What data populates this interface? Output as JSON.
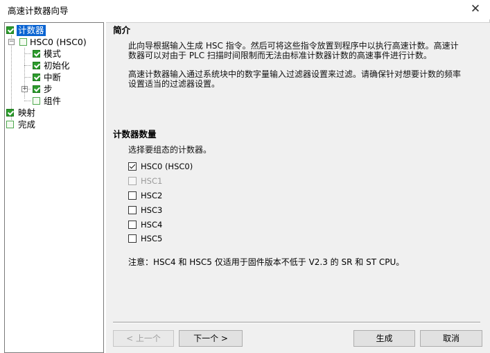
{
  "window": {
    "title": "高速计数器向导",
    "close_symbol": "✕"
  },
  "tree": {
    "items": [
      {
        "label": "计数器",
        "checked": true,
        "selected": true
      },
      {
        "label": "HSC0 (HSC0)",
        "checked": false
      },
      {
        "label": "模式",
        "checked": true
      },
      {
        "label": "初始化",
        "checked": true
      },
      {
        "label": "中断",
        "checked": true
      },
      {
        "label": "步",
        "checked": true
      },
      {
        "label": "组件",
        "checked": false
      },
      {
        "label": "映射",
        "checked": true
      },
      {
        "label": "完成",
        "checked": false
      }
    ]
  },
  "intro": {
    "heading": "简介",
    "para1": "此向导根据输入生成 HSC 指令。然后可将这些指令放置到程序中以执行高速计数。高速计数器可以对由于 PLC 扫描时间限制而无法由标准计数器计数的高速事件进行计数。",
    "para2": "高速计数器输入通过系统块中的数字量输入过滤器设置来过滤。请确保针对想要计数的频率设置适当的过滤器设置。"
  },
  "counters": {
    "heading": "计数器数量",
    "prompt": "选择要组态的计数器。",
    "items": [
      {
        "label": "HSC0 (HSC0)",
        "checked": true,
        "enabled": true
      },
      {
        "label": "HSC1",
        "checked": false,
        "enabled": false
      },
      {
        "label": "HSC2",
        "checked": false,
        "enabled": true
      },
      {
        "label": "HSC3",
        "checked": false,
        "enabled": true
      },
      {
        "label": "HSC4",
        "checked": false,
        "enabled": true
      },
      {
        "label": "HSC5",
        "checked": false,
        "enabled": true
      }
    ],
    "note": "注意：HSC4 和 HSC5 仅适用于固件版本不低于 V2.3 的 SR 和 ST CPU。"
  },
  "buttons": {
    "prev": "< 上一个",
    "next": "下一个 >",
    "generate": "生成",
    "cancel": "取消"
  }
}
